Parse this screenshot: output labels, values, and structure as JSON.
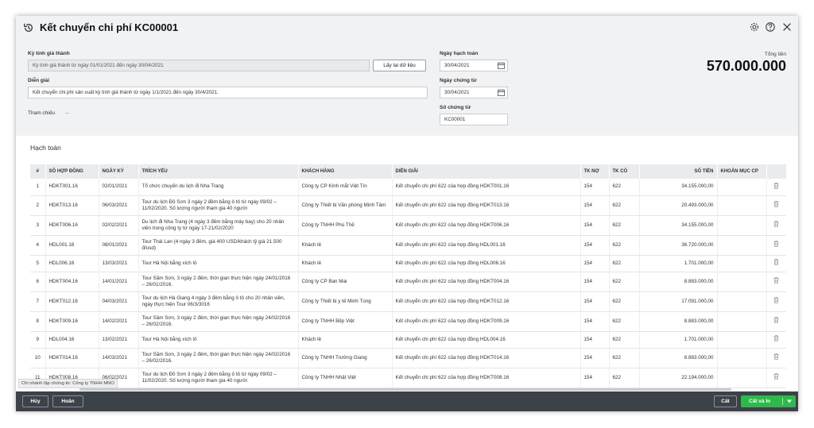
{
  "header": {
    "title": "Kết chuyển chi phí KC00001"
  },
  "form": {
    "ky_tinh_gia_thanh_label": "Kỳ tính giá thành",
    "ky_tinh_gia_thanh_value": "Kỳ tính giá thành từ ngày 01/01/2021 đến ngày 30/04/2021",
    "reload_button": "Lấy lại dữ liệu",
    "dien_giai_label": "Diễn giải",
    "dien_giai_value": "Kết chuyển chi phí sản xuất kỳ tính giá thành từ ngày 1/1/2021 đến ngày 30/4/2021.",
    "tham_chieu_label": "Tham chiếu",
    "tham_chieu_value": "...",
    "ngay_hach_toan_label": "Ngày hạch toán",
    "ngay_hach_toan_value": "30/04/2021",
    "ngay_chung_tu_label": "Ngày chứng từ",
    "ngay_chung_tu_value": "30/04/2021",
    "so_chung_tu_label": "Số chứng từ",
    "so_chung_tu_value": "KC00001",
    "tong_tien_label": "Tổng tiền",
    "tong_tien_value": "570.000.000"
  },
  "section": {
    "title": "Hạch toán"
  },
  "table": {
    "columns": [
      "#",
      "SỐ HỢP ĐỒNG",
      "NGÀY KÝ",
      "TRÍCH YẾU",
      "KHÁCH HÀNG",
      "DIỄN GIẢI",
      "TK NỢ",
      "TK CÓ",
      "SỐ TIỀN",
      "KHOẢN MỤC CP"
    ],
    "rows": [
      [
        "1",
        "HDKT001.16",
        "02/01/2021",
        "Tổ chức chuyến du lịch đi Nha Trang",
        "Công ty CP Kính mắt Việt Tín",
        "Kết chuyển chi phí 622 của hợp đồng HDKT001.16",
        "154",
        "622",
        "34.155.000,00",
        ""
      ],
      [
        "2",
        "HDKT013.16",
        "06/03/2021",
        "Tour du lịch Đồ Sơn 3 ngày 2 đêm bằng ô tô từ ngày 09/02 – 11/02/2020. Số lượng người tham gia 40 người",
        "Công ty Thiết bị Văn phòng Minh Tâm",
        "Kết chuyển chi phí 622 của hợp đồng HDKT013.16",
        "154",
        "622",
        "20.493.000,00",
        ""
      ],
      [
        "3",
        "HDKT006.16",
        "02/02/2021",
        "Du lịch đi Nha Trang (4 ngày 3 đêm bằng máy bay) cho 20 nhân viên trong công ty từ ngày 17-21/02/2020",
        "Công ty TNHH Phú Thế",
        "Kết chuyển chi phí 622 của hợp đồng HDKT006.16",
        "154",
        "622",
        "34.155.000,00",
        ""
      ],
      [
        "4",
        "HDL001.16",
        "08/01/2021",
        "Tour Thái Lan (4 ngày 3 đêm, giá 400 USD/khách tỷ giá 21.500 đ/usd)",
        "Khách lẻ",
        "Kết chuyển chi phí 622 của hợp đồng HDL001.16",
        "154",
        "622",
        "36.720.000,00",
        ""
      ],
      [
        "5",
        "HDL006.16",
        "13/03/2021",
        "Tour Hà Nội bằng xích lô",
        "Khách lẻ",
        "Kết chuyển chi phí 622 của hợp đồng HDL006.16",
        "154",
        "622",
        "1.701.000,00",
        ""
      ],
      [
        "6",
        "HDKT004.16",
        "14/01/2021",
        "Tour Sầm Sơn, 3 ngày 2 đêm, thời gian thực hiện ngày 24/01/2016 – 26/01/2016.",
        "Công ty CP Ban Mai",
        "Kết chuyển chi phí 622 của hợp đồng HDKT004.16",
        "154",
        "622",
        "8.883.000,00",
        ""
      ],
      [
        "7",
        "HDKT012.16",
        "04/03/2021",
        "Tour du lịch Hà Giang 4 ngày 3 đêm bằng ô tô cho 20 nhân viên, ngày thực hiện Tour 06/3/3016",
        "Công ty Thiết bị y tế Minh Tùng",
        "Kết chuyển chi phí 622 của hợp đồng HDKT012.16",
        "154",
        "622",
        "17.091.000,00",
        ""
      ],
      [
        "8",
        "HDKT009.16",
        "14/02/2021",
        "Tour Sầm Sơn, 3 ngày 2 đêm, thời gian thực hiện ngày 24/02/2016 – 26/02/2016.",
        "Công ty TNHH Bếp Việt",
        "Kết chuyển chi phí 622 của hợp đồng HDKT009.16",
        "154",
        "622",
        "8.883.000,00",
        ""
      ],
      [
        "9",
        "HDL004.16",
        "13/02/2021",
        "Tour Hà Nội bằng xích lô",
        "Khách lẻ",
        "Kết chuyển chi phí 622 của hợp đồng HDL004.16",
        "154",
        "622",
        "1.701.000,00",
        ""
      ],
      [
        "10",
        "HDKT014.16",
        "14/03/2021",
        "Tour Sầm Sơn, 3 ngày 2 đêm, thời gian thực hiện ngày 24/02/2016 – 26/02/2016.",
        "Công ty TNHH Trường Giang",
        "Kết chuyển chi phí 622 của hợp đồng HDKT014.16",
        "154",
        "622",
        "8.883.000,00",
        ""
      ],
      [
        "11",
        "HDKT008.16",
        "06/02/2021",
        "Tour du lịch Đồ Sơn 3 ngày 2 đêm bằng ô tô từ ngày 09/02 – 11/02/2020. Số lượng người tham gia 40 người",
        "Công ty TNHH Nhật Việt",
        "Kết chuyển chi phí 622 của hợp đồng HDKT008.16",
        "154",
        "622",
        "22.194.000,00",
        ""
      ]
    ]
  },
  "branch_tooltip": "Chi nhánh lập chứng từ: Công ty TNHH MNO",
  "footer": {
    "cancel": "Hủy",
    "undo": "Hoãn",
    "save": "Cất",
    "save_print": "Cất và In"
  },
  "colors": {
    "accent_green": "#2fb94a",
    "footer_bg": "#3d4148",
    "panel_bg": "#f1f2f4"
  },
  "icons": [
    "history-icon",
    "gear-icon",
    "help-icon",
    "close-icon",
    "calendar-icon",
    "trash-icon",
    "chevron-down-icon"
  ]
}
